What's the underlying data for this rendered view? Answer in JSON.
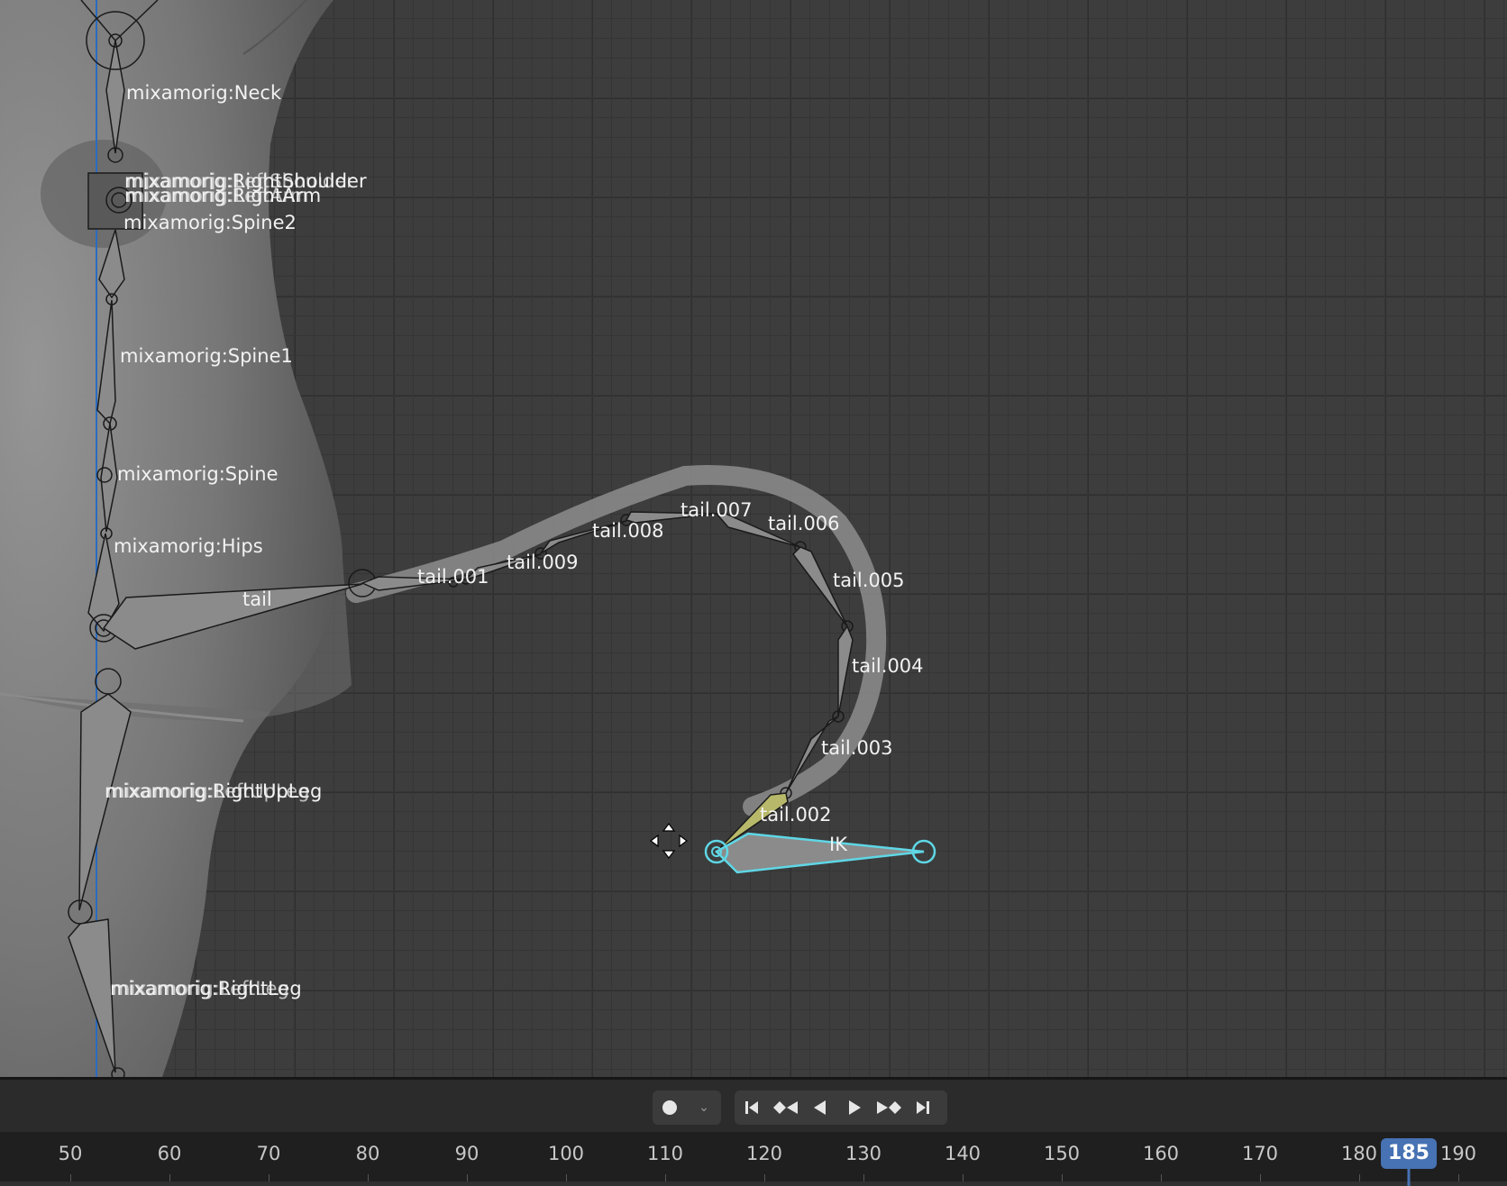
{
  "viewport": {
    "bones": {
      "neck": "mixamorig:Neck",
      "shoulder_overlap": "mixamorig:RightShoulder",
      "shoulder_overlap2": "mixamorig:LeftShoulder",
      "arm_overlap": "mixamorig:RightArm",
      "arm_overlap2": "mixamorig:LeftArm",
      "spine2": "mixamorig:Spine2",
      "spine1": "mixamorig:Spine1",
      "spine": "mixamorig:Spine",
      "hips": "mixamorig:Hips",
      "upleg_a": "mixamorig:RightUpLeg",
      "upleg_b": "mixamorig:LeftUpLeg",
      "leg_a": "mixamorig:RightLeg",
      "leg_b": "mixamorig:LeftLeg",
      "tail": "tail",
      "tail_001": "tail.001",
      "tail_002": "tail.002",
      "tail_003": "tail.003",
      "tail_004": "tail.004",
      "tail_005": "tail.005",
      "tail_006": "tail.006",
      "tail_007": "tail.007",
      "tail_008": "tail.008",
      "tail_009": "tail.009",
      "ik": "IK"
    },
    "colors": {
      "selected_bone": "#5fd7e6",
      "active_bone": "#b8b86a",
      "axis_line": "#2b6bbf"
    }
  },
  "timeline": {
    "transport": {
      "record_icon": "record-icon",
      "jump_start_icon": "jump-to-start-icon",
      "prev_keyframe_icon": "prev-keyframe-icon",
      "play_reverse_icon": "play-reverse-icon",
      "play_icon": "play-icon",
      "next_keyframe_icon": "next-keyframe-icon",
      "jump_end_icon": "jump-to-end-icon"
    },
    "ticks": [
      "50",
      "60",
      "70",
      "80",
      "90",
      "100",
      "110",
      "120",
      "130",
      "140",
      "150",
      "160",
      "170",
      "180",
      "190"
    ],
    "current_frame": "185"
  }
}
